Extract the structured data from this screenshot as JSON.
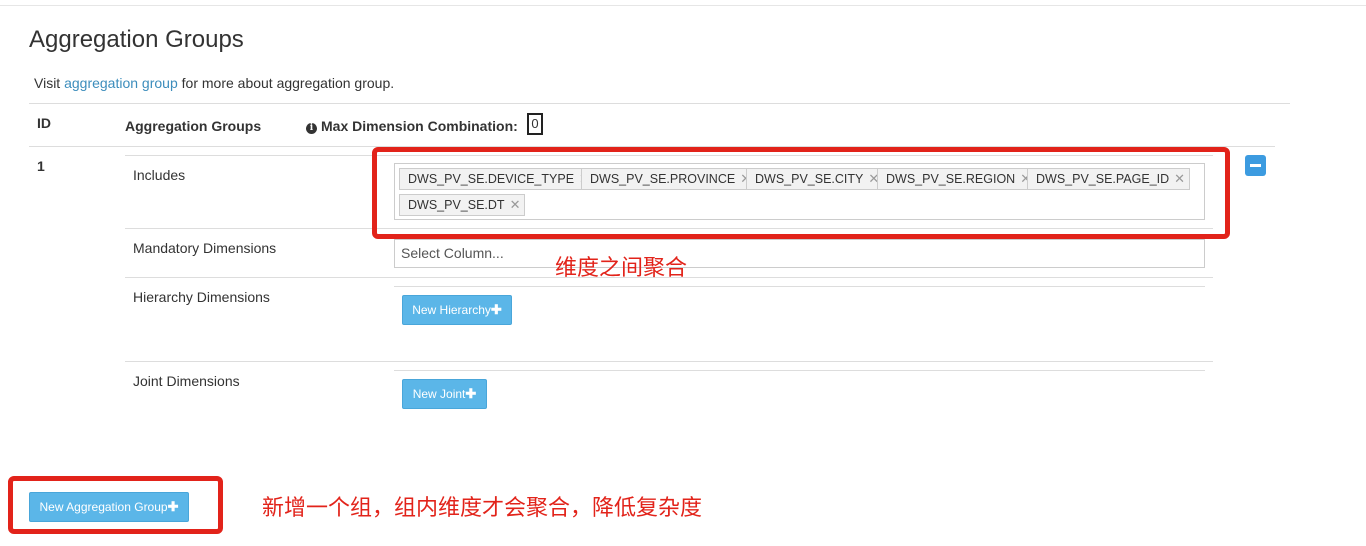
{
  "page": {
    "title": "Aggregation Groups",
    "intro_prefix": "Visit ",
    "intro_link": "aggregation group",
    "intro_suffix": " for more about aggregation group."
  },
  "table": {
    "col_id": "ID",
    "col_groups": "Aggregation Groups",
    "col_max": "Max Dimension Combination:",
    "max_value": "0"
  },
  "group": {
    "id": "1",
    "includes_label": "Includes",
    "includes": [
      "DWS_PV_SE.DEVICE_TYPE",
      "DWS_PV_SE.PROVINCE",
      "DWS_PV_SE.CITY",
      "DWS_PV_SE.REGION",
      "DWS_PV_SE.PAGE_ID",
      "DWS_PV_SE.DT"
    ],
    "mandatory_label": "Mandatory Dimensions",
    "mandatory_placeholder": "Select Column...",
    "hierarchy_label": "Hierarchy Dimensions",
    "new_hierarchy_button": "New Hierarchy",
    "joint_label": "Joint Dimensions",
    "new_joint_button": "New Joint"
  },
  "footer": {
    "new_group_button": "New Aggregation Group"
  },
  "annotations": {
    "includes_note": "维度之间聚合",
    "new_group_note": "新增一个组，组内维度才会聚合，降低复杂度",
    "color": "#e2231a"
  },
  "theme": {
    "button_color": "#5bb6e8",
    "link_color": "#3c8dbc"
  },
  "icons": {
    "info": "info-icon",
    "plus": "plus-icon",
    "remove_tag": "close-icon",
    "remove_group": "minus-icon"
  }
}
